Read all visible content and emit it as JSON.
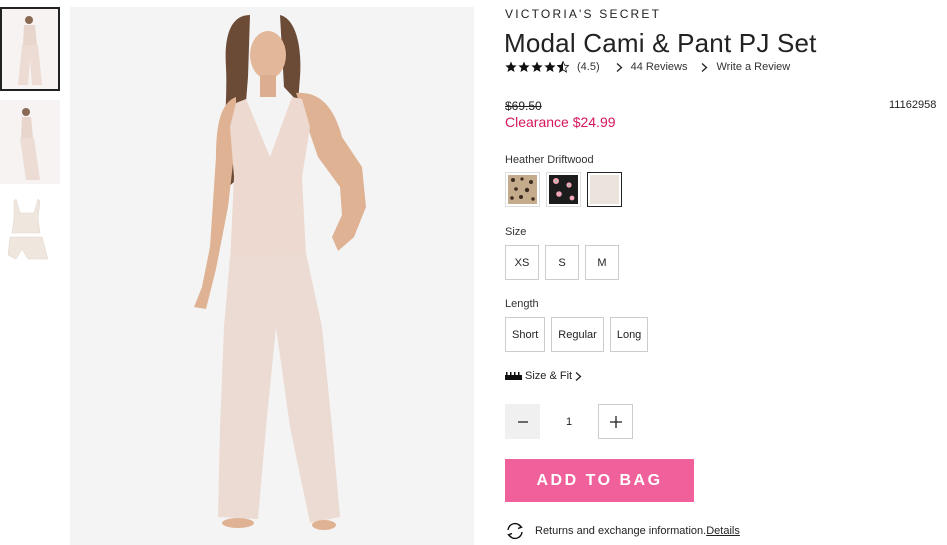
{
  "gallery": {
    "thumbnails": [
      "thumb-front",
      "thumb-side",
      "thumb-flat"
    ],
    "active_index": 0
  },
  "product": {
    "brand": "VICTORIA'S SECRET",
    "title": "Modal Cami & Pant PJ Set",
    "rating_value": "(4.5)",
    "rating_stars": 4.5,
    "reviews_link": "44 Reviews",
    "write_review_link": "Write a Review",
    "original_price": "$69.50",
    "sale_price": "Clearance $24.99",
    "sku": "11162958"
  },
  "color": {
    "selected_label": "Heather Driftwood",
    "swatches": [
      {
        "name": "leopard-swatch",
        "color": "#b59a7c"
      },
      {
        "name": "floral-black-swatch",
        "color": "#1c1c1c"
      },
      {
        "name": "heather-driftwood-swatch",
        "color": "#ebe4dc"
      }
    ]
  },
  "size": {
    "label": "Size",
    "options": [
      "XS",
      "S",
      "M"
    ]
  },
  "length": {
    "label": "Length",
    "options": [
      "Short",
      "Regular",
      "Long"
    ]
  },
  "fit": {
    "label": "Size & Fit"
  },
  "quantity": {
    "value": "1"
  },
  "cta": {
    "add_to_bag": "ADD TO BAG",
    "accent_color": "#f0609a"
  },
  "returns": {
    "text": "Returns and exchange information.",
    "link": "Details"
  }
}
